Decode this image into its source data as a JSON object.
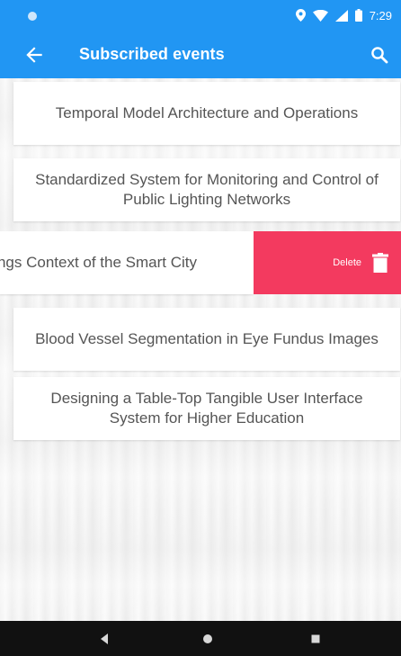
{
  "status_bar": {
    "time": "7:29",
    "icons": [
      "app-dot-icon",
      "location-icon",
      "wifi-icon",
      "signal-icon",
      "battery-icon"
    ]
  },
  "app_bar": {
    "title": "Subscribed events",
    "back_icon": "arrow-left-icon",
    "search_icon": "search-icon",
    "background": "#2196f3"
  },
  "events": [
    {
      "title": "Temporal Model Architecture and Operations"
    },
    {
      "title": "Standardized System for Monitoring and Control of Public Lighting Networks"
    },
    {
      "title": "ngs Context of the Smart City"
    },
    {
      "title": "Blood Vessel Segmentation in Eye Fundus Images"
    },
    {
      "title": "Designing a Table-Top Tangible User Interface System for Higher Education"
    }
  ],
  "swipe_action": {
    "label": "Delete",
    "icon": "trash-icon",
    "color": "#f33a5f"
  },
  "nav_bar": {
    "buttons": [
      "back-triangle-icon",
      "home-circle-icon",
      "recents-square-icon"
    ]
  }
}
